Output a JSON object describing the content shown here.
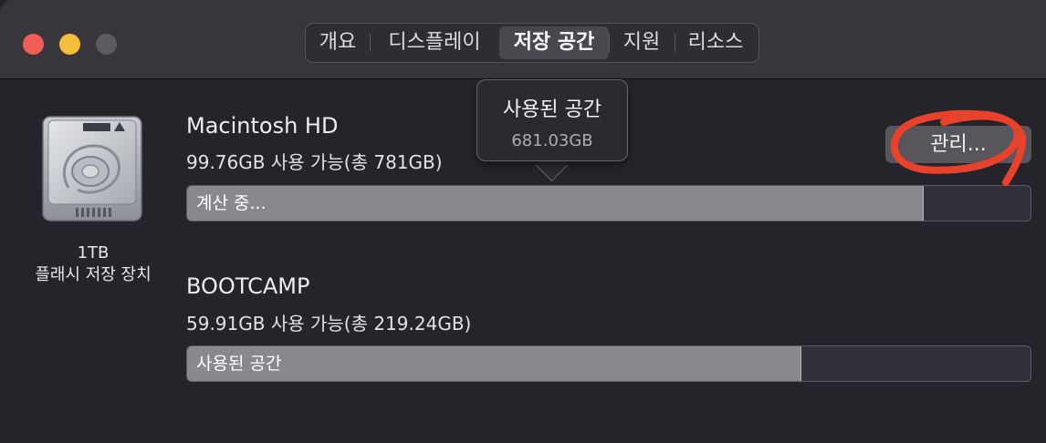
{
  "tabs": [
    {
      "label": "개요",
      "active": false
    },
    {
      "label": "디스플레이",
      "active": false
    },
    {
      "label": "저장 공간",
      "active": true
    },
    {
      "label": "지원",
      "active": false
    },
    {
      "label": "리소스",
      "active": false
    }
  ],
  "disk": {
    "icon": "hard-drive-icon",
    "size_label": "1TB",
    "type_label": "플래시 저장 장치"
  },
  "volumes": [
    {
      "name": "Macintosh HD",
      "availability": "99.76GB 사용 가능(총 781GB)",
      "bar_label": "계산 중...",
      "used_fraction": 0.872
    },
    {
      "name": "BOOTCAMP",
      "availability": "59.91GB 사용 가능(총 219.24GB)",
      "bar_label": "사용된 공간",
      "used_fraction": 0.727
    }
  ],
  "tooltip": {
    "title": "사용된 공간",
    "value": "681.03GB"
  },
  "manage_button": {
    "label": "관리..."
  },
  "colors": {
    "annotation": "#e8412c",
    "bar_used": "#8a878d",
    "bar_free": "#332f38",
    "close": "#ee5e56",
    "minimize": "#f4be3c"
  }
}
